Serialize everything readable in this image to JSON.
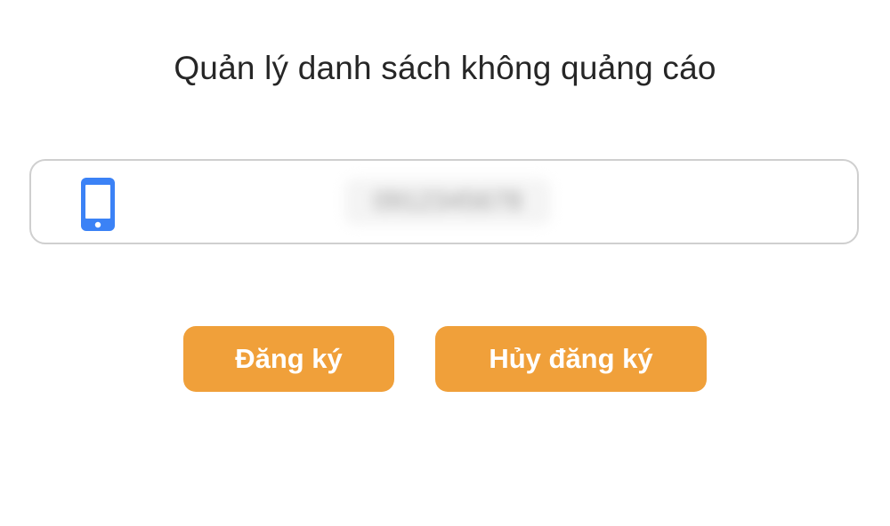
{
  "page": {
    "title": "Quản lý danh sách không quảng cáo"
  },
  "phone_input": {
    "icon": "mobile-phone-icon",
    "value": "0912345678",
    "value_obscured": true
  },
  "buttons": {
    "register_label": "Đăng ký",
    "unregister_label": "Hủy đăng ký"
  },
  "colors": {
    "accent": "#f0a03a",
    "icon": "#3b82f6",
    "field_border": "#cfcfcf",
    "title_text": "#262626",
    "button_text": "#ffffff"
  }
}
